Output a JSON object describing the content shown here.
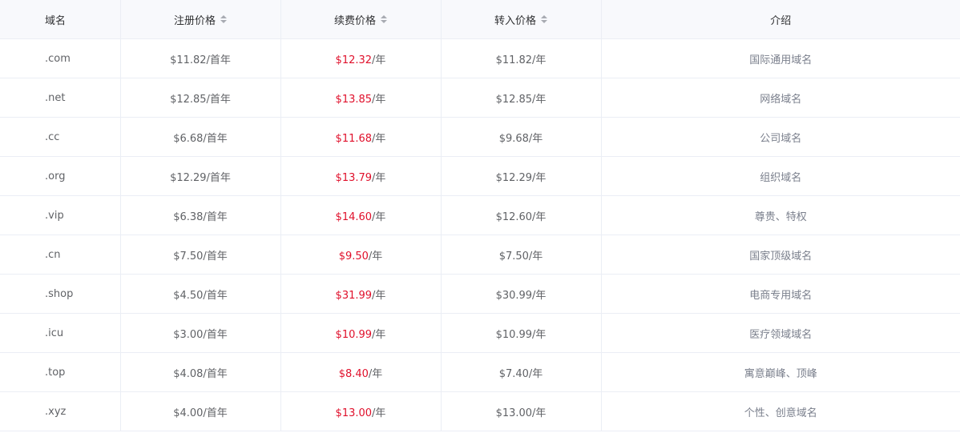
{
  "table": {
    "headers": {
      "domain": "域名",
      "register": "注册价格",
      "renew": "续费价格",
      "transfer": "转入价格",
      "intro": "介绍"
    },
    "rows": [
      {
        "domain": ".com",
        "register": "$11.82/首年",
        "renew_price": "$12.32",
        "renew_unit": "/年",
        "transfer": "$11.82/年",
        "intro": "国际通用域名"
      },
      {
        "domain": ".net",
        "register": "$12.85/首年",
        "renew_price": "$13.85",
        "renew_unit": "/年",
        "transfer": "$12.85/年",
        "intro": "网络域名"
      },
      {
        "domain": ".cc",
        "register": "$6.68/首年",
        "renew_price": "$11.68",
        "renew_unit": "/年",
        "transfer": "$9.68/年",
        "intro": "公司域名"
      },
      {
        "domain": ".org",
        "register": "$12.29/首年",
        "renew_price": "$13.79",
        "renew_unit": "/年",
        "transfer": "$12.29/年",
        "intro": "组织域名"
      },
      {
        "domain": ".vip",
        "register": "$6.38/首年",
        "renew_price": "$14.60",
        "renew_unit": "/年",
        "transfer": "$12.60/年",
        "intro": "尊贵、特权"
      },
      {
        "domain": ".cn",
        "register": "$7.50/首年",
        "renew_price": "$9.50",
        "renew_unit": "/年",
        "transfer": "$7.50/年",
        "intro": "国家顶级域名"
      },
      {
        "domain": ".shop",
        "register": "$4.50/首年",
        "renew_price": "$31.99",
        "renew_unit": "/年",
        "transfer": "$30.99/年",
        "intro": "电商专用域名"
      },
      {
        "domain": ".icu",
        "register": "$3.00/首年",
        "renew_price": "$10.99",
        "renew_unit": "/年",
        "transfer": "$10.99/年",
        "intro": "医疗领域域名"
      },
      {
        "domain": ".top",
        "register": "$4.08/首年",
        "renew_price": "$8.40",
        "renew_unit": "/年",
        "transfer": "$7.40/年",
        "intro": "寓意巅峰、顶峰"
      },
      {
        "domain": ".xyz",
        "register": "$4.00/首年",
        "renew_price": "$13.00",
        "renew_unit": "/年",
        "transfer": "$13.00/年",
        "intro": "个性、创意域名"
      }
    ]
  },
  "icons": {
    "sort": "sort-caret-icon"
  },
  "colors": {
    "header_bg": "#f8f9fc",
    "border": "#ebeef5",
    "renew_price": "#e0102b",
    "text": "#606266"
  }
}
